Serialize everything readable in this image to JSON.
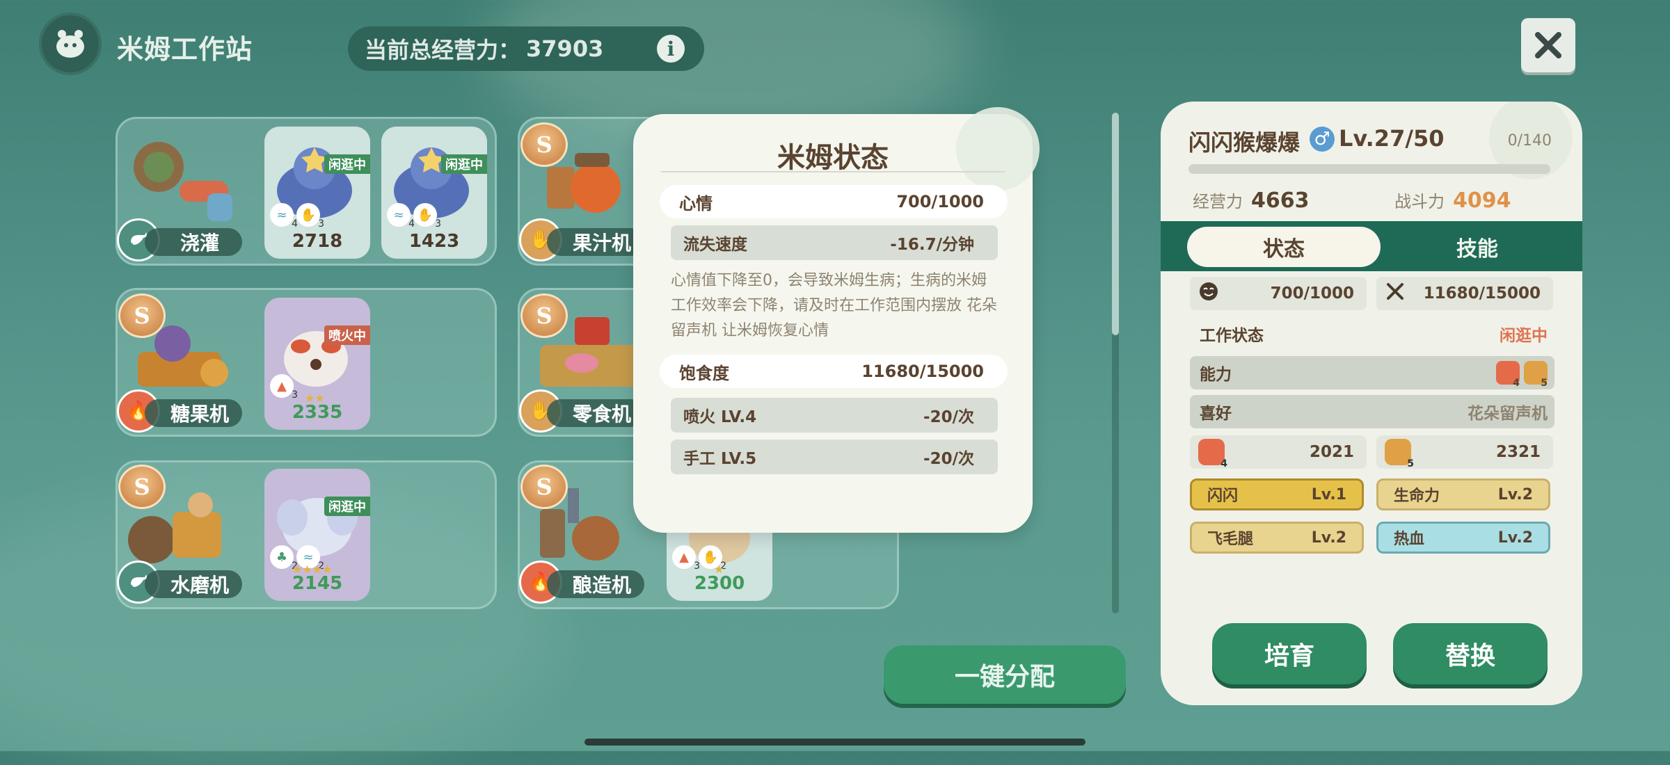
{
  "header": {
    "title": "米姆工作站",
    "power_label": "当前总经营力：",
    "power_value": "37903",
    "info_glyph": "i"
  },
  "machines": [
    {
      "name": "浇灌",
      "badge": "water-icon"
    },
    {
      "name": "果汁机",
      "badge": "hand-icon"
    },
    {
      "name": "糖果机",
      "badge": "fire-icon"
    },
    {
      "name": "零食机",
      "badge": "hand-icon"
    },
    {
      "name": "水磨机",
      "badge": "water-icon"
    },
    {
      "name": "酿造机",
      "badge": "fire-icon"
    }
  ],
  "pets": [
    {
      "value": "2718",
      "status": "闲逛中",
      "icons": [
        "4",
        "3"
      ]
    },
    {
      "value": "1423",
      "status": "闲逛中",
      "icons": [
        "4",
        "3"
      ]
    },
    {
      "value": "2335",
      "status": "喷火中",
      "icons": [
        "3"
      ],
      "stars": "★★"
    },
    {
      "value": "2145",
      "status": "闲逛中",
      "icons": [
        "2",
        "2"
      ],
      "stars": "★★★★"
    },
    {
      "value": "2300",
      "icons": [
        "3",
        "2"
      ],
      "stars": "★"
    }
  ],
  "popup": {
    "title": "米姆状态",
    "mood_label": "心情",
    "mood_value": "700/1000",
    "loss_label": "流失速度",
    "loss_value": "-16.7/分钟",
    "description": "心情值下降至0，会导致米姆生病；生病的米姆工作效率会下降，请及时在工作范围内摆放 花朵留声机 让米姆恢复心情",
    "satiety_label": "饱食度",
    "satiety_value": "11680/15000",
    "skills": [
      {
        "label": "喷火 LV.4",
        "value": "-20/次"
      },
      {
        "label": "手工 LV.5",
        "value": "-20/次"
      }
    ]
  },
  "panel": {
    "pet_name": "闪闪猴爆爆",
    "gender": "♂",
    "level": "Lv.27/50",
    "exp": "0/140",
    "business_label": "经营力",
    "business_value": "4663",
    "combat_label": "战斗力",
    "combat_value": "4094",
    "tabs": [
      "状态",
      "技能"
    ],
    "mood_value": "700/1000",
    "food_value": "11680/15000",
    "work_state_label": "工作状态",
    "work_state_value": "闲逛中",
    "ability_label": "能力",
    "ability_levels": [
      "4",
      "5"
    ],
    "hobby_label": "喜好",
    "hobby_value": "花朵留声机",
    "fire_level": "4",
    "fire_value": "2021",
    "hand_level": "5",
    "hand_value": "2321",
    "traits": [
      {
        "name": "闪闪",
        "level": "Lv.1"
      },
      {
        "name": "生命力",
        "level": "Lv.2"
      },
      {
        "name": "飞毛腿",
        "level": "Lv.2"
      },
      {
        "name": "热血",
        "level": "Lv.2"
      }
    ],
    "train_btn": "培育",
    "replace_btn": "替换"
  },
  "assign_btn": "一键分配",
  "colors": {
    "accent": "#2f8c63",
    "warning": "#e0734f",
    "bg": "#4f8f85"
  }
}
